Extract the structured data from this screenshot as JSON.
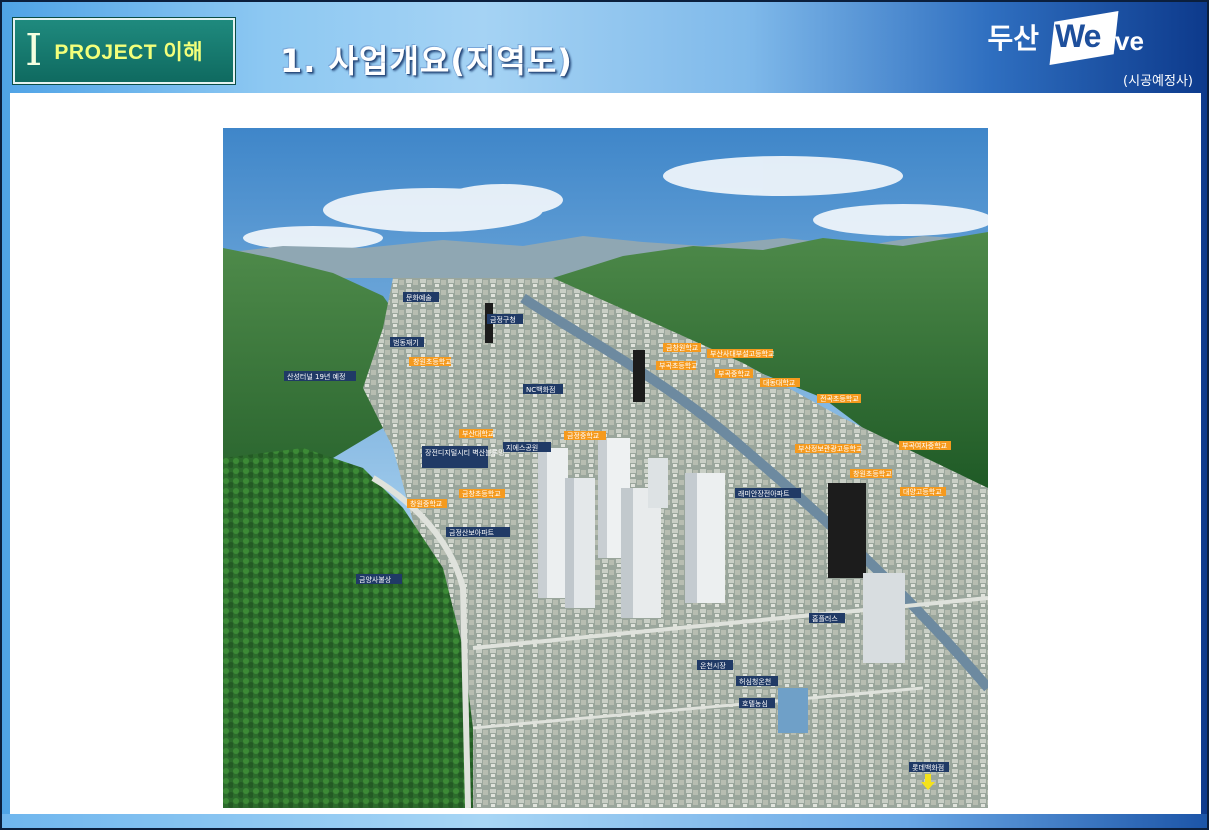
{
  "header": {
    "section_roman": "I",
    "section_label": "PROJECT 이해",
    "title": "1. 사업개요(지역도)"
  },
  "logo": {
    "brand_ko": "두산",
    "brand_en_a": "We",
    "brand_en_b": "ve",
    "subtitle": "(시공예정사)"
  },
  "map_labels": {
    "orange": [
      "창원초등학교",
      "부산대학교",
      "금정중학교",
      "금창초등학교",
      "창원중학교",
      "금창원학교",
      "부산사대부설고등학교",
      "부곡초등학교",
      "부곡중학교",
      "대동대학교",
      "전곡초등학교",
      "부산정보관광고등학교",
      "부곡여자중학교",
      "창원초등학교",
      "대양고등학교"
    ],
    "blue": [
      "문화예술",
      "금정구청",
      "범동재기",
      "산성터널 19년 예정",
      "NC백화점",
      "지에스공원",
      "장전디지털시티 벽산블루밍",
      "금정산보아파트",
      "금양사불상",
      "래미안장전아파트",
      "홈플러스",
      "온천시장",
      "허심청온천",
      "호텔농심",
      "롯데백화점"
    ]
  },
  "colors": {
    "badge_teal": "#0f6a60",
    "badge_text": "#f3ff7a",
    "header_dark": "#0d3a8c",
    "label_orange": "#f59a1e",
    "label_blue": "#203a66"
  }
}
